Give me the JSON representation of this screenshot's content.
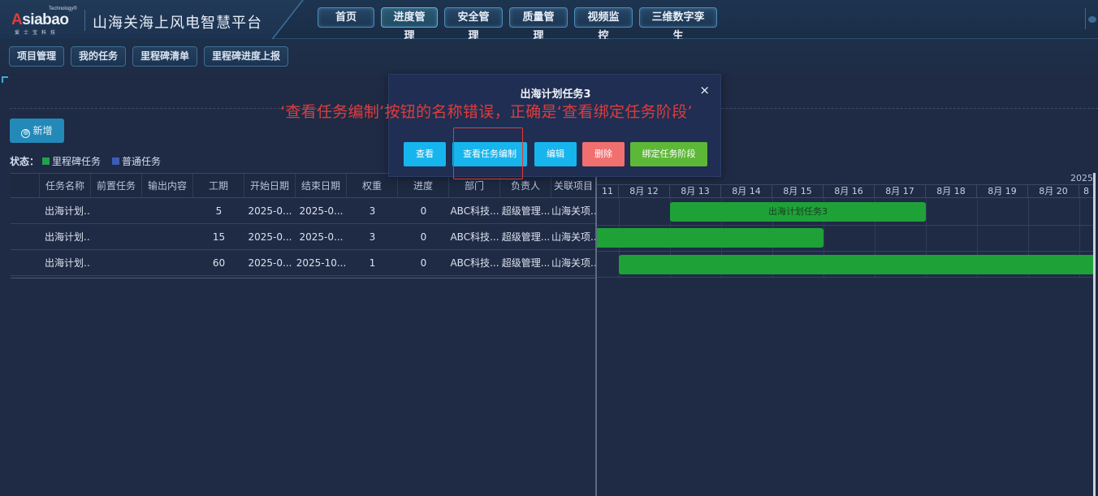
{
  "header": {
    "logo_tech": "Technology®",
    "logo_text_a": "A",
    "logo_text_rest": "siabao",
    "logo_sub": "爱士宝科技",
    "title": "山海关海上风电智慧平台",
    "nav": [
      "首页",
      "进度管理",
      "安全管理",
      "质量管理",
      "视频监控",
      "三维数字孪生"
    ]
  },
  "subnav": [
    "项目管理",
    "我的任务",
    "里程碑清单",
    "里程碑进度上报"
  ],
  "toolbar": {
    "add_label": "新增",
    "add_icon": "⊕"
  },
  "status": {
    "label": "状态：",
    "legend": [
      {
        "name": "里程碑任务",
        "color": "#1ea44e"
      },
      {
        "name": "普通任务",
        "color": "#3b5cb7"
      }
    ]
  },
  "table": {
    "headers": [
      "",
      "任务名称",
      "前置任务",
      "输出内容",
      "工期",
      "开始日期",
      "结束日期",
      "权重",
      "进度",
      "部门",
      "负责人",
      "关联项目"
    ],
    "rows": [
      [
        "",
        "出海计划...",
        "",
        "",
        "5",
        "2025-0...",
        "2025-0...",
        "3",
        "0",
        "ABC科技...",
        "超级管理...",
        "山海关项..."
      ],
      [
        "",
        "出海计划...",
        "",
        "",
        "15",
        "2025-0...",
        "2025-0...",
        "3",
        "0",
        "ABC科技...",
        "超级管理...",
        "山海关项..."
      ],
      [
        "",
        "出海计划...",
        "",
        "",
        "60",
        "2025-0...",
        "2025-10...",
        "1",
        "0",
        "ABC科技...",
        "超级管理...",
        "山海关项..."
      ]
    ]
  },
  "gantt": {
    "year": "2025",
    "days": [
      "11",
      "8月 12",
      "8月 13",
      "8月 14",
      "8月 15",
      "8月 16",
      "8月 17",
      "8月 18",
      "8月 19",
      "8月 20",
      "8"
    ],
    "bar_label": "出海计划任务3"
  },
  "modal": {
    "title": "出海计划任务3",
    "close": "×",
    "buttons": [
      "查看",
      "查看任务编制",
      "编辑",
      "删除",
      "绑定任务阶段"
    ]
  },
  "annotation": "‘查看任务编制’按钮的名称错误，正确是‘查看绑定任务阶段’",
  "colors": {
    "accent": "#2389b8",
    "milestone": "#1ea44e",
    "normal": "#3b5cb7",
    "error": "#e53935"
  }
}
